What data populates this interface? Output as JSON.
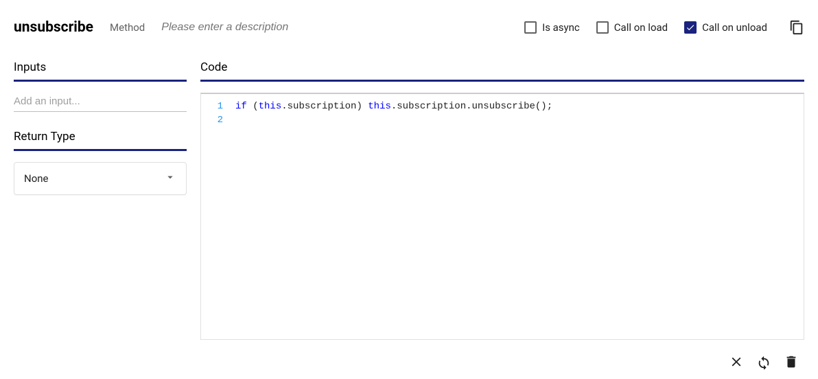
{
  "header": {
    "name": "unsubscribe",
    "type_label": "Method",
    "description_placeholder": "Please enter a description",
    "opts": {
      "is_async_label": "Is async",
      "is_async_checked": false,
      "call_on_load_label": "Call on load",
      "call_on_load_checked": false,
      "call_on_unload_label": "Call on unload",
      "call_on_unload_checked": true
    }
  },
  "sections": {
    "inputs_title": "Inputs",
    "add_input_placeholder": "Add an input...",
    "return_type_title": "Return Type",
    "return_type_value": "None",
    "code_title": "Code"
  },
  "code": {
    "line_numbers": [
      "1",
      "2"
    ],
    "tokens_line1": [
      {
        "t": "if",
        "c": "kw"
      },
      {
        "t": " (",
        "c": "plain"
      },
      {
        "t": "this",
        "c": "kw"
      },
      {
        "t": ".subscription) ",
        "c": "plain"
      },
      {
        "t": "this",
        "c": "kw"
      },
      {
        "t": ".subscription.unsubscribe();",
        "c": "plain"
      }
    ]
  },
  "icons": {
    "copy": "copy-icon",
    "close": "close-icon",
    "refresh": "refresh-icon",
    "delete": "delete-icon",
    "chevron_down": "chevron-down-icon",
    "check": "check-icon"
  }
}
